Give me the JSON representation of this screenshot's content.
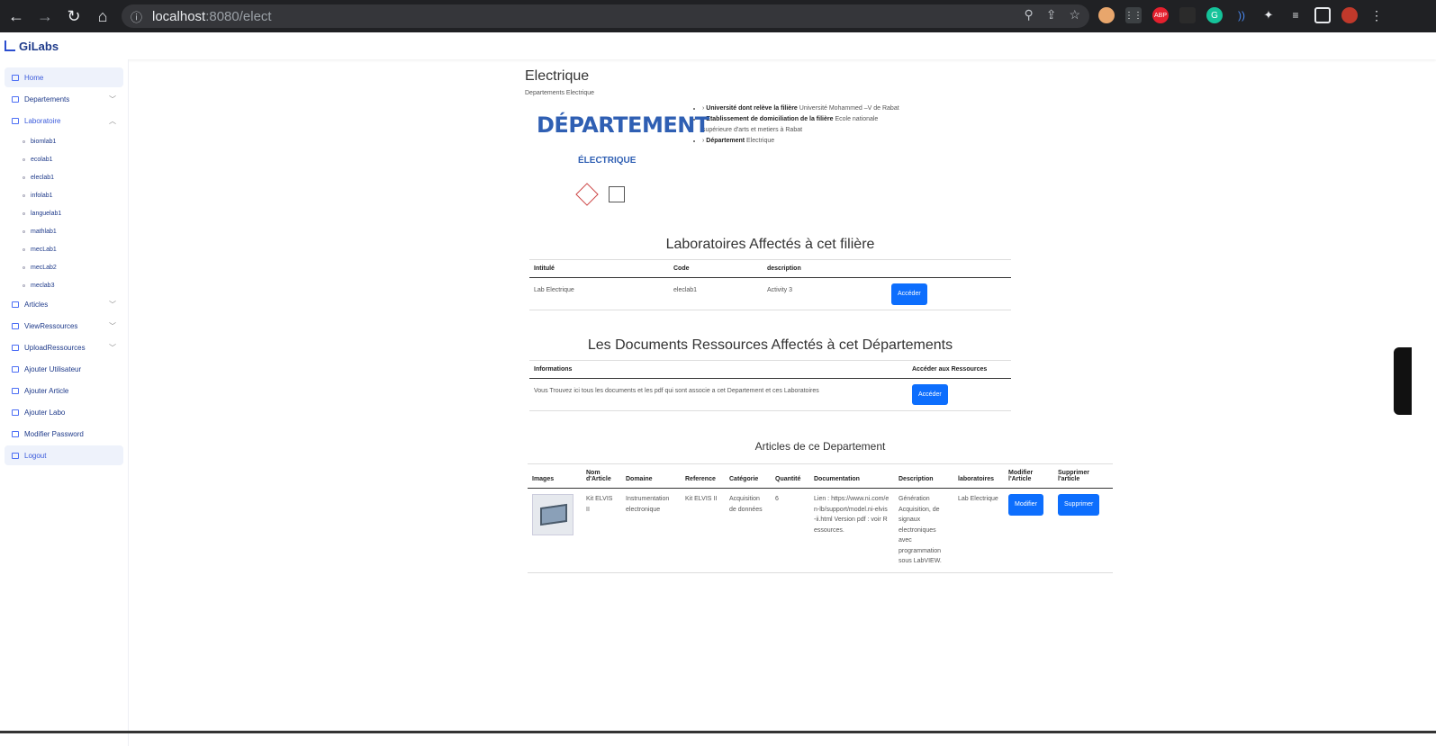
{
  "browser": {
    "url_host": "localhost",
    "url_path": ":8080/elect"
  },
  "app": {
    "name": "GiLabs"
  },
  "sidebar": {
    "items": [
      {
        "label": "Home"
      },
      {
        "label": "Departements"
      },
      {
        "label": "Laboratoire"
      },
      {
        "label": "Articles"
      },
      {
        "label": "ViewRessources"
      },
      {
        "label": "UploadRessources"
      },
      {
        "label": "Ajouter Utilisateur"
      },
      {
        "label": "Ajouter Article"
      },
      {
        "label": "Ajouter Labo"
      },
      {
        "label": "Modifier Password"
      },
      {
        "label": "Logout"
      }
    ],
    "labs": [
      "biomlab1",
      "ecolab1",
      "eleclab1",
      "infolab1",
      "languelab1",
      "mathlab1",
      "mecLab1",
      "mecLab2",
      "meclab3"
    ]
  },
  "page": {
    "title": "Electrique",
    "breadcrumb": "Departements Electrique",
    "logo_big": "DÉPARTEMENT",
    "logo_small": "ÉLECTRIQUE",
    "info": [
      {
        "label": "Université dont relève la filière",
        "value": "Université Mohammed –V de Rabat"
      },
      {
        "label": "Etablissement de domiciliation de la filière",
        "value": "Ecole nationale supérieure d'arts et metiers à Rabat"
      },
      {
        "label": "Département",
        "value": "Electrique"
      }
    ]
  },
  "labs_section": {
    "title": "Laboratoires Affectés à cet filière",
    "headers": [
      "Intitulé",
      "Code",
      "description",
      ""
    ],
    "row": {
      "intitule": "Lab Electrique",
      "code": "eleclab1",
      "description": "Activity 3",
      "button": "Accéder"
    }
  },
  "docs_section": {
    "title": "Les Documents Ressources Affectés à cet Départements",
    "headers": [
      "Informations",
      "Accéder aux Ressources"
    ],
    "row": {
      "text": "Vous Trouvez ici tous les documents et les pdf qui sont associe a cet Departement et ces Laboratoires",
      "button": "Accéder"
    }
  },
  "articles_section": {
    "title": "Articles de ce Departement",
    "headers": [
      "Images",
      "Nom d'Article",
      "Domaine",
      "Reference",
      "Catégorie",
      "Quantité",
      "Documentation",
      "Description",
      "laboratoires",
      "Modifier l'Article",
      "Supprimer l'article"
    ],
    "row": {
      "nom": "Kit ELVIS II",
      "domaine": "Instrumentation electronique",
      "reference": "Kit ELVIS II",
      "categorie": "Acquisition de données",
      "quantite": "6",
      "documentation": "Lien : https://www.ni.com/en-lb/support/model.ni-elvis-ii.html Version pdf : voir Ressources.",
      "description": "Génération Acquisition, de signaux electroniques avec programmation sous LabVIEW.",
      "laboratoire": "Lab Electrique",
      "modifier": "Modifier",
      "supprimer": "Supprimer"
    }
  }
}
